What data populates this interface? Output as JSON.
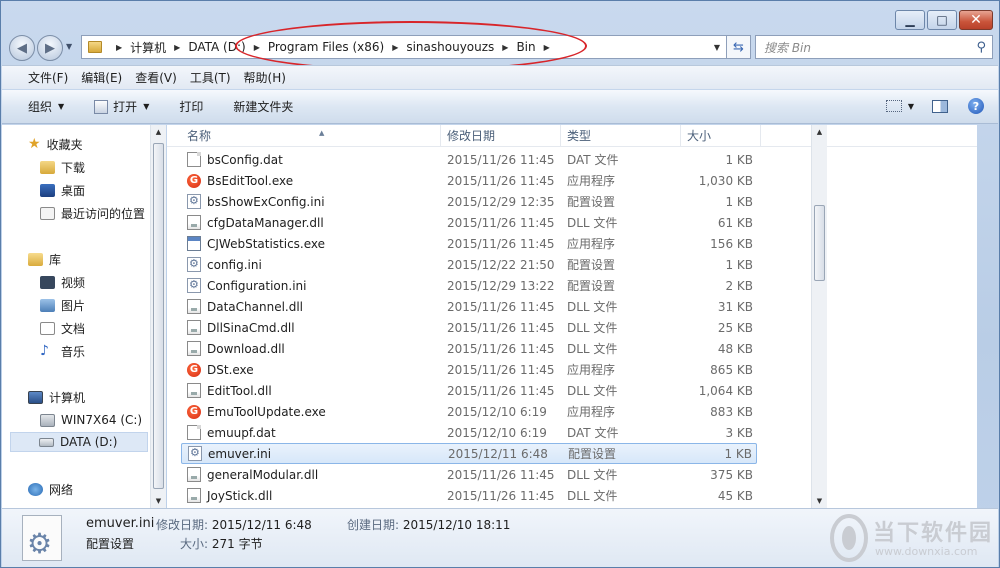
{
  "window": {
    "caption_buttons": [
      "minimize-icon",
      "maximize-icon",
      "close-icon"
    ]
  },
  "address": {
    "crumbs": [
      "计算机",
      "DATA (D:)",
      "Program Files (x86)",
      "sinashouyouzs",
      "Bin"
    ],
    "search_placeholder": "搜索 Bin"
  },
  "menu": [
    "文件(F)",
    "编辑(E)",
    "查看(V)",
    "工具(T)",
    "帮助(H)"
  ],
  "toolbar": {
    "organize": "组织",
    "open": "打开",
    "print": "打印",
    "new_folder": "新建文件夹"
  },
  "nav": {
    "favorites": "收藏夹",
    "downloads": "下载",
    "desktop": "桌面",
    "recent": "最近访问的位置",
    "libraries": "库",
    "videos": "视频",
    "pictures": "图片",
    "documents": "文档",
    "music": "音乐",
    "computer": "计算机",
    "drive_c": "WIN7X64 (C:)",
    "drive_d": "DATA (D:)",
    "network": "网络"
  },
  "columns": {
    "name": "名称",
    "date": "修改日期",
    "type": "类型",
    "size": "大小"
  },
  "files": [
    {
      "name": "bsConfig.dat",
      "date": "2015/11/26 11:45",
      "type": "DAT 文件",
      "size": "1 KB",
      "icon": "doc"
    },
    {
      "name": "BsEditTool.exe",
      "date": "2015/11/26 11:45",
      "type": "应用程序",
      "size": "1,030 KB",
      "icon": "exe-g"
    },
    {
      "name": "bsShowExConfig.ini",
      "date": "2015/12/29 12:35",
      "type": "配置设置",
      "size": "1 KB",
      "icon": "ini"
    },
    {
      "name": "cfgDataManager.dll",
      "date": "2015/11/26 11:45",
      "type": "DLL 文件",
      "size": "61 KB",
      "icon": "dll"
    },
    {
      "name": "CJWebStatistics.exe",
      "date": "2015/11/26 11:45",
      "type": "应用程序",
      "size": "156 KB",
      "icon": "exe-w"
    },
    {
      "name": "config.ini",
      "date": "2015/12/22 21:50",
      "type": "配置设置",
      "size": "1 KB",
      "icon": "ini"
    },
    {
      "name": "Configuration.ini",
      "date": "2015/12/29 13:22",
      "type": "配置设置",
      "size": "2 KB",
      "icon": "ini"
    },
    {
      "name": "DataChannel.dll",
      "date": "2015/11/26 11:45",
      "type": "DLL 文件",
      "size": "31 KB",
      "icon": "dll"
    },
    {
      "name": "DllSinaCmd.dll",
      "date": "2015/11/26 11:45",
      "type": "DLL 文件",
      "size": "25 KB",
      "icon": "dll"
    },
    {
      "name": "Download.dll",
      "date": "2015/11/26 11:45",
      "type": "DLL 文件",
      "size": "48 KB",
      "icon": "dll"
    },
    {
      "name": "DSt.exe",
      "date": "2015/11/26 11:45",
      "type": "应用程序",
      "size": "865 KB",
      "icon": "exe-g"
    },
    {
      "name": "EditTool.dll",
      "date": "2015/11/26 11:45",
      "type": "DLL 文件",
      "size": "1,064 KB",
      "icon": "dll"
    },
    {
      "name": "EmuToolUpdate.exe",
      "date": "2015/12/10 6:19",
      "type": "应用程序",
      "size": "883 KB",
      "icon": "exe-g"
    },
    {
      "name": "emuupf.dat",
      "date": "2015/12/10 6:19",
      "type": "DAT 文件",
      "size": "3 KB",
      "icon": "doc"
    },
    {
      "name": "emuver.ini",
      "date": "2015/12/11 6:48",
      "type": "配置设置",
      "size": "1 KB",
      "icon": "ini",
      "selected": true
    },
    {
      "name": "generalModular.dll",
      "date": "2015/11/26 11:45",
      "type": "DLL 文件",
      "size": "375 KB",
      "icon": "dll"
    },
    {
      "name": "JoyStick.dll",
      "date": "2015/11/26 11:45",
      "type": "DLL 文件",
      "size": "45 KB",
      "icon": "dll"
    }
  ],
  "details": {
    "filename": "emuver.ini",
    "filetype": "配置设置",
    "modified_label": "修改日期:",
    "modified_value": "2015/12/11 6:48",
    "created_label": "创建日期:",
    "created_value": "2015/12/10 18:11",
    "size_label": "大小:",
    "size_value": "271 字节"
  },
  "watermark": {
    "title": "当下软件园",
    "url": "www.downxia.com"
  },
  "colors": {
    "annotation": "#d8252a",
    "selection": "#d7e7f9"
  }
}
